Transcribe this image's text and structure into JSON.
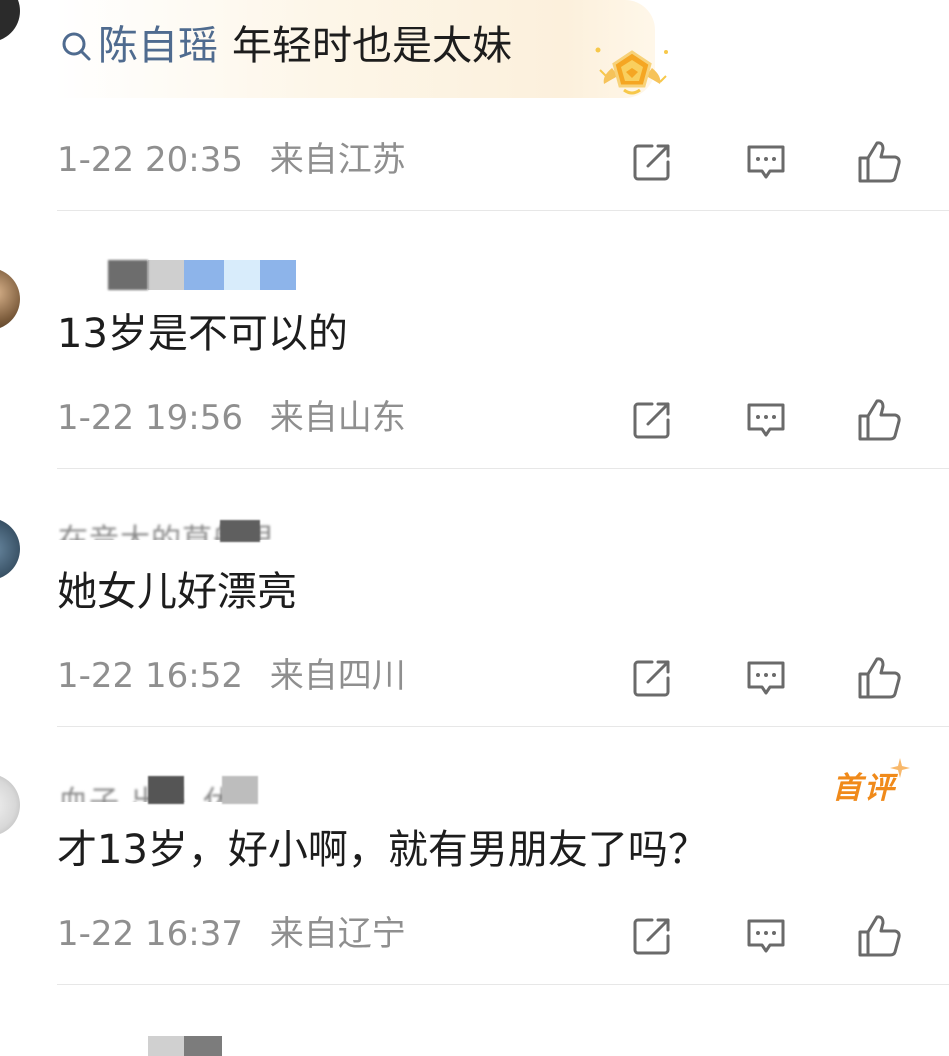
{
  "top_comment": {
    "search_link": "陈自瑶",
    "text": "年轻时也是太妹",
    "time": "1-22 20:35",
    "location": "来自江苏",
    "badge_icon": "gold-pentagon-badge-icon"
  },
  "comments": [
    {
      "text": "13岁是不可以的",
      "time": "1-22 19:56",
      "location": "来自山东"
    },
    {
      "username_fragment": "在音大的草船里",
      "text": "她女儿好漂亮",
      "time": "1-22 16:52",
      "location": "来自四川"
    },
    {
      "username_fragment": "血子 出队 休",
      "first_comment_badge": "首评",
      "text": "才13岁，好小啊，就有男朋友了吗？",
      "time": "1-22 16:37",
      "location": "来自辽宁"
    }
  ],
  "icons": {
    "share": "share-icon",
    "reply": "comment-icon",
    "like": "thumbs-up-icon"
  },
  "colors": {
    "link": "#4f6b8f",
    "meta": "#8f8f8f",
    "icon": "#6a6a6a",
    "first_badge": "#f08a1a"
  }
}
